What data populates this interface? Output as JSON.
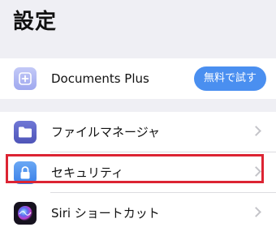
{
  "header": {
    "title": "設定"
  },
  "promo": {
    "icon": "plus-icon",
    "label": "Documents Plus",
    "button_label": "無料で試す",
    "button_color": "#4a8ff0"
  },
  "settings": {
    "items": [
      {
        "label": "ファイルマネージャ",
        "icon": "folder-icon"
      },
      {
        "label": "セキュリティ",
        "icon": "lock-icon"
      },
      {
        "label": "Siri ショートカット",
        "icon": "siri-icon"
      }
    ]
  },
  "highlight": {
    "target": "security",
    "color": "#dc2433"
  }
}
